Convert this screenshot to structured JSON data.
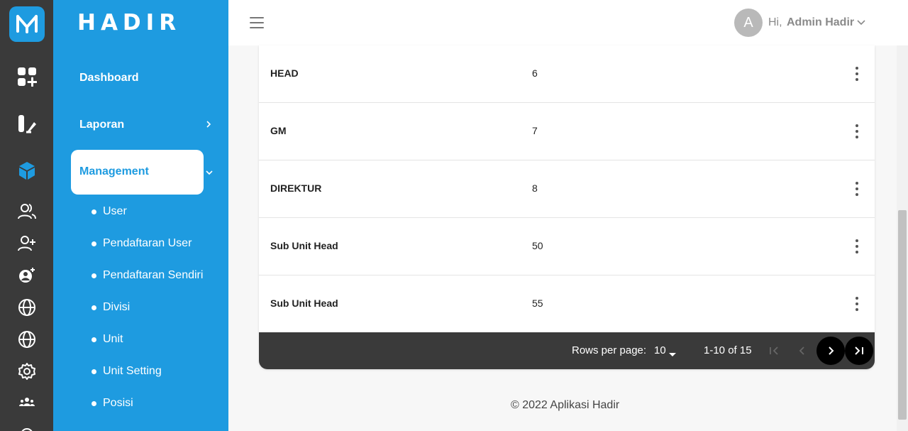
{
  "brand": {
    "name": "HADIR"
  },
  "menu": {
    "dashboard": "Dashboard",
    "laporan": "Laporan",
    "management": "Management",
    "submenu": [
      "User",
      "Pendaftaran User",
      "Pendaftaran Sendiri",
      "Divisi",
      "Unit",
      "Unit Setting",
      "Posisi"
    ]
  },
  "header": {
    "avatar_letter": "A",
    "greeting": "Hi,",
    "user_name": "Admin Hadir"
  },
  "table": {
    "rows": [
      {
        "name": "HEAD",
        "value": "6"
      },
      {
        "name": "GM",
        "value": "7"
      },
      {
        "name": "DIREKTUR",
        "value": "8"
      },
      {
        "name": "Sub Unit Head",
        "value": "50"
      },
      {
        "name": "Sub Unit Head",
        "value": "55"
      }
    ],
    "pagination": {
      "rows_per_page_label": "Rows per page:",
      "rows_per_page_value": "10",
      "range": "1-10 of 15"
    }
  },
  "footer": {
    "copyright": "© 2022 Aplikasi Hadir"
  },
  "colors": {
    "primary": "#1e9be0",
    "rail": "#3a3a3a",
    "pager": "#3a3a3a"
  }
}
